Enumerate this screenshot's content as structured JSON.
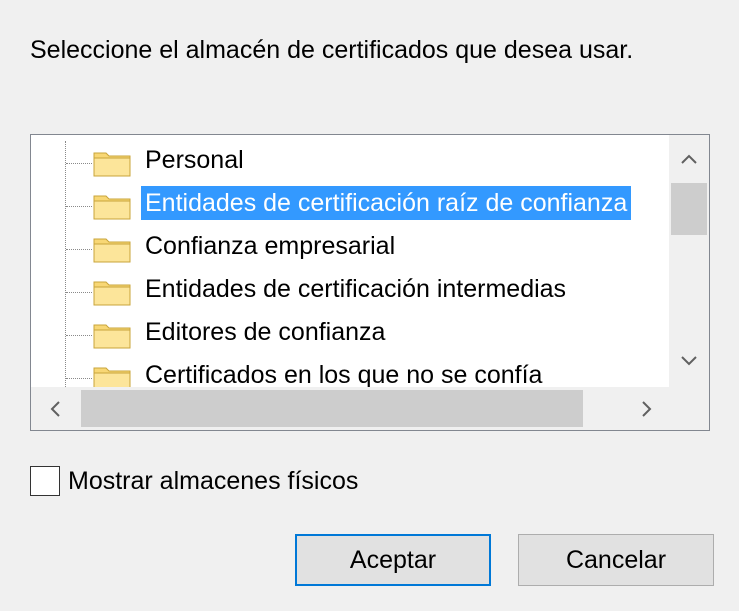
{
  "dialog": {
    "prompt": "Seleccione el almacén de certificados que desea usar.",
    "show_physical_label": "Mostrar almacenes físicos",
    "show_physical_checked": false,
    "ok_label": "Aceptar",
    "cancel_label": "Cancelar"
  },
  "tree": {
    "selected_index": 1,
    "items": [
      {
        "label": "Personal",
        "icon": "folder-icon"
      },
      {
        "label": "Entidades de certificación raíz de confianza",
        "icon": "folder-icon"
      },
      {
        "label": "Confianza empresarial",
        "icon": "folder-icon"
      },
      {
        "label": "Entidades de certificación intermedias",
        "icon": "folder-icon"
      },
      {
        "label": "Editores de confianza",
        "icon": "folder-icon"
      },
      {
        "label": "Certificados en los que no se confía",
        "icon": "folder-icon"
      }
    ]
  },
  "colors": {
    "selection": "#3399ff",
    "folder": "#f8d775",
    "default_button_border": "#0078d7"
  }
}
